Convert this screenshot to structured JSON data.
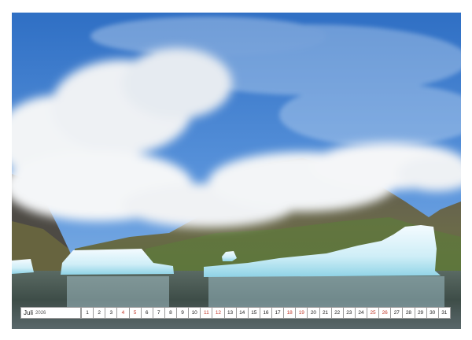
{
  "calendar": {
    "month": "Juli",
    "year": "2026",
    "days": [
      {
        "n": "1",
        "weekend": false
      },
      {
        "n": "2",
        "weekend": false
      },
      {
        "n": "3",
        "weekend": false
      },
      {
        "n": "4",
        "weekend": true
      },
      {
        "n": "5",
        "weekend": true
      },
      {
        "n": "6",
        "weekend": false
      },
      {
        "n": "7",
        "weekend": false
      },
      {
        "n": "8",
        "weekend": false
      },
      {
        "n": "9",
        "weekend": false
      },
      {
        "n": "10",
        "weekend": false
      },
      {
        "n": "11",
        "weekend": true
      },
      {
        "n": "12",
        "weekend": true
      },
      {
        "n": "13",
        "weekend": false
      },
      {
        "n": "14",
        "weekend": false
      },
      {
        "n": "15",
        "weekend": false
      },
      {
        "n": "16",
        "weekend": false
      },
      {
        "n": "17",
        "weekend": false
      },
      {
        "n": "18",
        "weekend": true
      },
      {
        "n": "19",
        "weekend": true
      },
      {
        "n": "20",
        "weekend": false
      },
      {
        "n": "21",
        "weekend": false
      },
      {
        "n": "22",
        "weekend": false
      },
      {
        "n": "23",
        "weekend": false
      },
      {
        "n": "24",
        "weekend": false
      },
      {
        "n": "25",
        "weekend": true
      },
      {
        "n": "26",
        "weekend": true
      },
      {
        "n": "27",
        "weekend": false
      },
      {
        "n": "28",
        "weekend": false
      },
      {
        "n": "29",
        "weekend": false
      },
      {
        "n": "30",
        "weekend": false
      },
      {
        "n": "31",
        "weekend": false
      }
    ]
  },
  "colors": {
    "weekend_text": "#c0392b",
    "weekday_text": "#222222"
  }
}
